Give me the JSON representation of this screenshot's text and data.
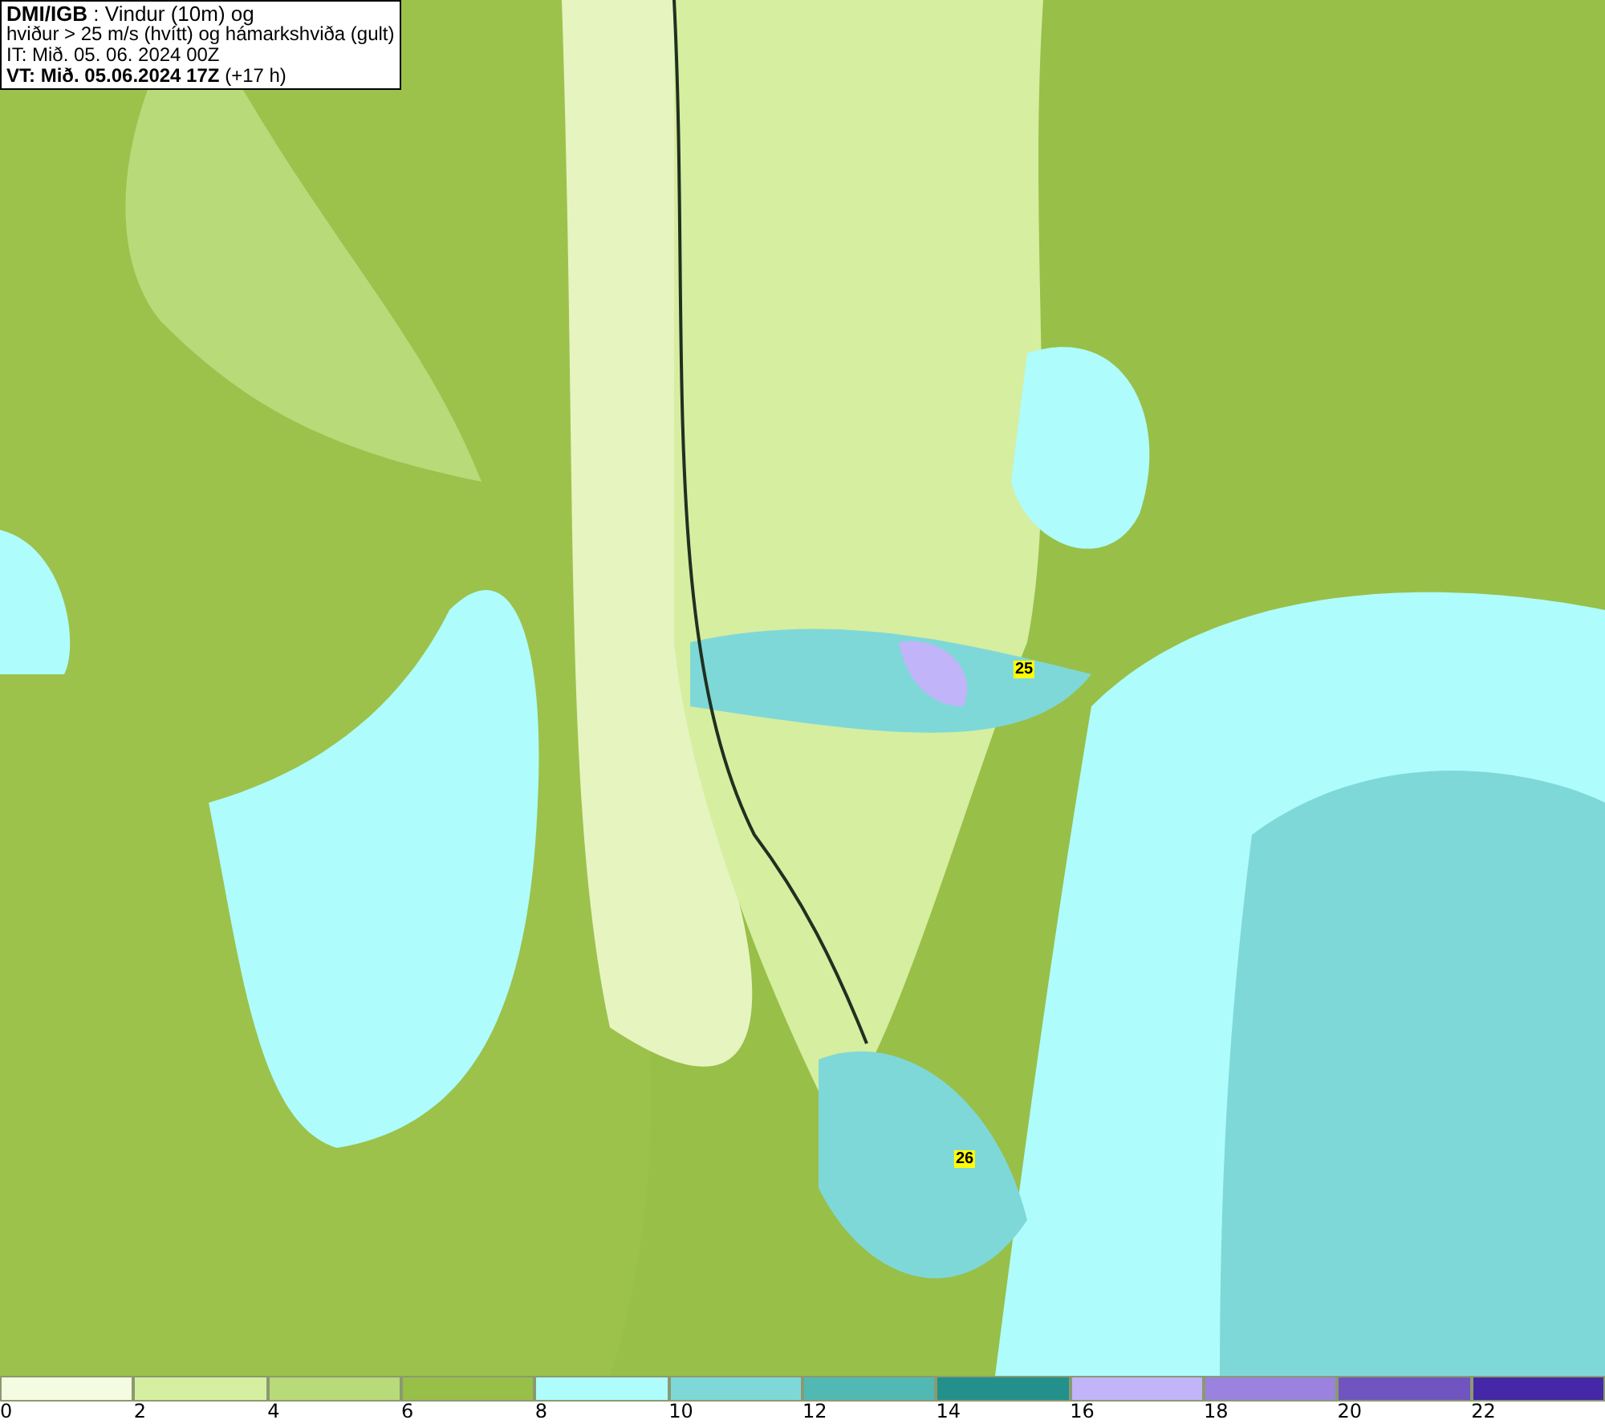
{
  "info_box": {
    "lines": [
      "**DMI/IGB** : Vindur (10m) og",
      "hviður > 25 m/s (hvítt) og hámarkshviða (gult)",
      "IT: Mið. 05. 06. 2024 00Z",
      "**VT: Mið. 05.06.2024 17Z** (+17 h)"
    ]
  },
  "map": {
    "gust_labels": [
      {
        "text": "25"
      },
      {
        "text": "26"
      }
    ]
  },
  "legend": {
    "bins": [
      {
        "label": "0",
        "color": "#f5fbe0"
      },
      {
        "label": "2",
        "color": "#d6eea0"
      },
      {
        "label": "4",
        "color": "#b8da78"
      },
      {
        "label": "6",
        "color": "#98bf48"
      },
      {
        "label": "8",
        "color": "#aefcfc"
      },
      {
        "label": "10",
        "color": "#7fd8d8"
      },
      {
        "label": "12",
        "color": "#52b8b4"
      },
      {
        "label": "14",
        "color": "#24908c"
      },
      {
        "label": "16",
        "color": "#c2b4f8"
      },
      {
        "label": "18",
        "color": "#9a82de"
      },
      {
        "label": "20",
        "color": "#7054c0"
      },
      {
        "label": "22",
        "color": "#4428a8"
      }
    ]
  }
}
